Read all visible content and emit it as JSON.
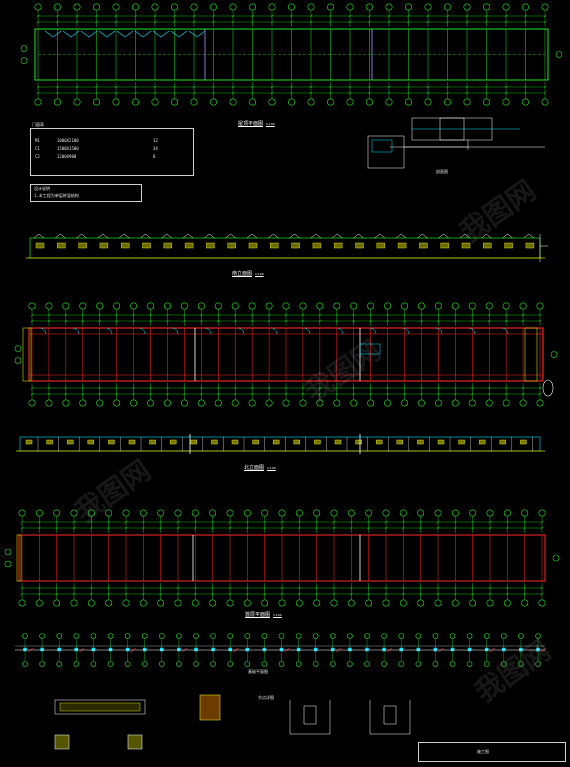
{
  "drawing_titles": {
    "plan_roof": "屋顶平面图",
    "section": "剖面图",
    "elevation_south": "南立面图",
    "plan_floor": "首层平面图",
    "elevation_north": "北立面图",
    "foundation": "基础平面图",
    "scale": "1:100"
  },
  "room_marks": [
    "①",
    "②",
    "③"
  ],
  "right_marker": "①",
  "table_title": "门窗表",
  "table_rows": [
    [
      "M1",
      "1000X2100",
      "12"
    ],
    [
      "C1",
      "1500X1500",
      "34"
    ],
    [
      "C2",
      "1200X900",
      "8"
    ]
  ],
  "notes": [
    "设计说明",
    "1.本工程为单层砖混结构"
  ],
  "detail_label": "节点详图",
  "title_block": "施工图",
  "colors": {
    "background": "#000000",
    "grid": "#22e622",
    "wall": "#ff2a2a",
    "dim": "#d8d800",
    "text": "#ffffff",
    "cyan": "#00e5ff"
  },
  "watermark": "我图网"
}
